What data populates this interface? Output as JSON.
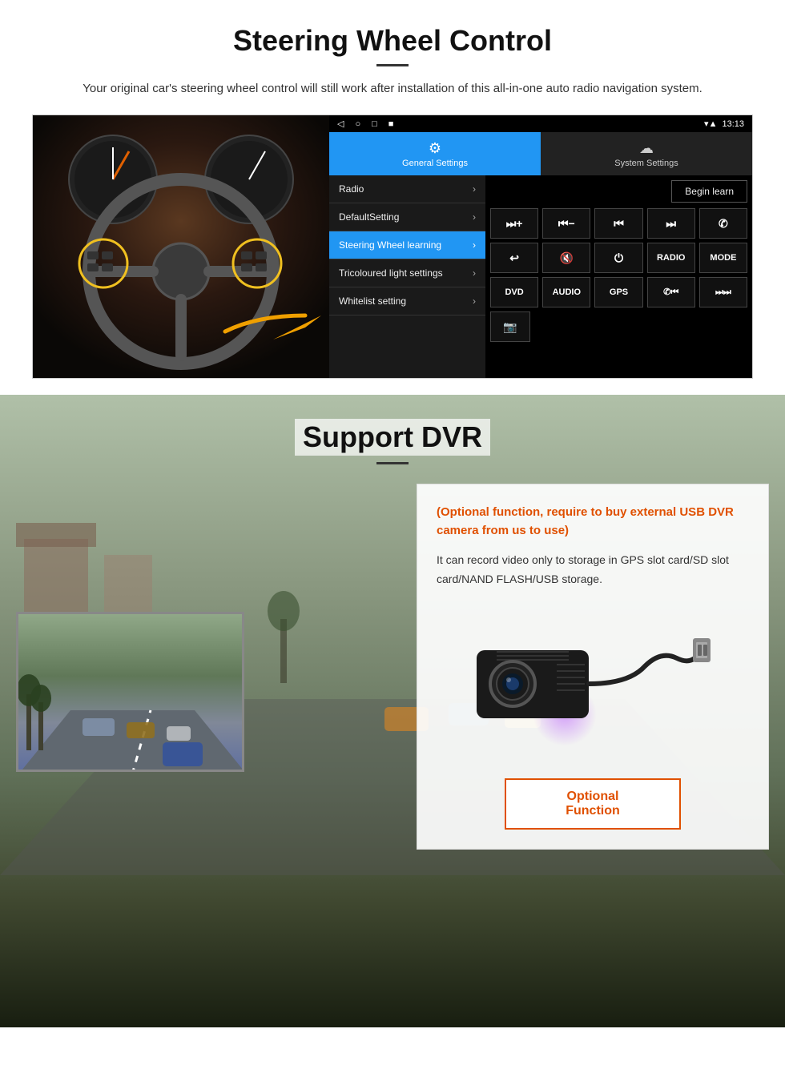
{
  "page": {
    "section1": {
      "title": "Steering Wheel Control",
      "description": "Your original car's steering wheel control will still work after installation of this all-in-one auto radio navigation system."
    },
    "android_ui": {
      "status_bar": {
        "nav_icons": [
          "◁",
          "○",
          "□",
          "■"
        ],
        "time": "13:13",
        "signal_icons": [
          "▾",
          "▲"
        ]
      },
      "tabs": [
        {
          "label": "General Settings",
          "icon": "⚙",
          "active": true
        },
        {
          "label": "System Settings",
          "icon": "☁",
          "active": false
        }
      ],
      "menu_items": [
        {
          "label": "Radio",
          "active": false
        },
        {
          "label": "DefaultSetting",
          "active": false
        },
        {
          "label": "Steering Wheel learning",
          "active": true
        },
        {
          "label": "Tricoloured light settings",
          "active": false
        },
        {
          "label": "Whitelist setting",
          "active": false
        }
      ],
      "begin_learn_label": "Begin learn",
      "control_buttons": [
        [
          "⏭+",
          "⏮−",
          "⏮⏮",
          "⏭⏭",
          "✆"
        ],
        [
          "↩",
          "🔇",
          "⏻",
          "RADIO",
          "MODE"
        ],
        [
          "DVD",
          "AUDIO",
          "GPS",
          "✆⏮",
          "⏭⏭⏭"
        ],
        [
          "📷"
        ]
      ]
    },
    "section2": {
      "title": "Support DVR",
      "optional_text": "(Optional function, require to buy external USB DVR camera from us to use)",
      "description": "It can record video only to storage in GPS slot card/SD slot card/NAND FLASH/USB storage.",
      "optional_btn_label": "Optional Function"
    }
  }
}
